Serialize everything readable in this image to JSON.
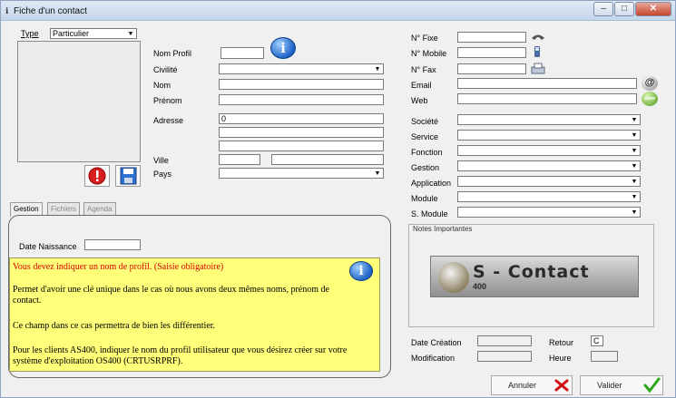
{
  "window": {
    "title": "Fiche d'un contact",
    "controls": [
      "–",
      "□",
      "✕"
    ]
  },
  "type": {
    "label": "Type",
    "value": "Particulier"
  },
  "identity": {
    "nom_profil": "Nom Profil",
    "civilite": "Civilité",
    "nom": "Nom",
    "prenom": "Prénom",
    "adresse": "Adresse",
    "adresse_value": "0",
    "ville": "Ville",
    "pays": "Pays"
  },
  "phones": {
    "fixe": "N° Fixe",
    "mobile": "N° Mobile",
    "fax": "N° Fax"
  },
  "internet": {
    "email": "Email",
    "web": "Web"
  },
  "company": {
    "societe": "Société",
    "service": "Service",
    "fonction": "Fonction",
    "gestion": "Gestion",
    "application": "Application",
    "module": "Module",
    "s_module": "S. Module"
  },
  "tabs": [
    "Gestion",
    "Fichiers",
    "Agenda"
  ],
  "gestion": {
    "date_naissance": "Date Naissance"
  },
  "tip": {
    "title": "Vous devez indiquer un nom de profil. (Saisie obligatoire)",
    "p1": "Permet d'avoir une clé unique dans le cas où nous avons deux mêmes noms, prénom de contact.",
    "p2": "Ce champ dans ce cas permettra de bien les différentier.",
    "p3": "Pour les clients AS400, indiquer le nom du profil utilisateur que vous désirez créer sur votre système d'exploitation OS400 (CRTUSRPRF)."
  },
  "notes": {
    "label": "Notes Importantes",
    "logo_text": "S - Contact",
    "logo_sub": "400"
  },
  "meta": {
    "date_creation": "Date Création",
    "modification": "Modification",
    "retour": "Retour",
    "retour_value": "C",
    "heure": "Heure"
  },
  "actions": {
    "annuler": "Annuler",
    "valider": "Valider"
  },
  "icons": {
    "info": "info-icon",
    "error": "error-icon",
    "save": "save-icon",
    "phone": "phone-icon",
    "mobile": "mobile-icon",
    "fax": "fax-icon",
    "email": "at-icon",
    "web": "www-icon",
    "cancel": "red-x-icon",
    "validate": "green-check-icon"
  },
  "colors": {
    "tip_bg": "#ffff7a",
    "tip_title": "#d60000",
    "info_blue": "#1e63c6"
  }
}
